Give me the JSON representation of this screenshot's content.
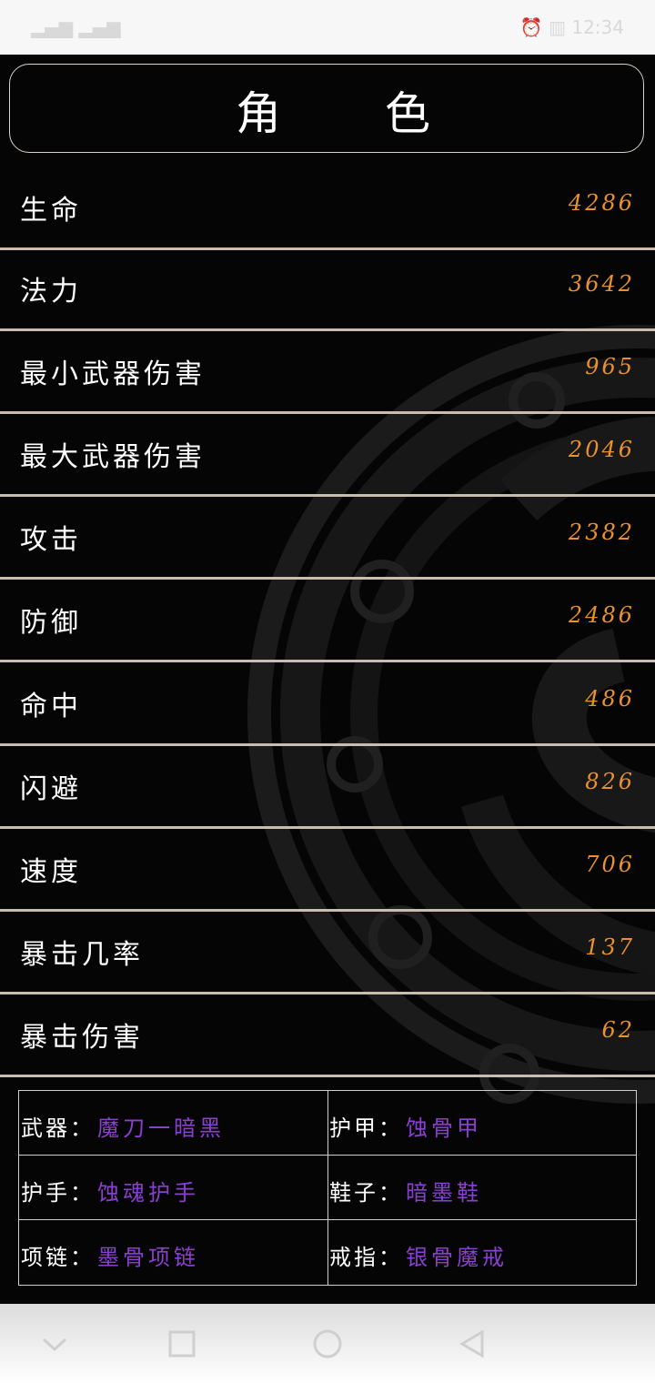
{
  "status_bar": {
    "left": "▂▄▆ ▂▄▆",
    "right": "⏰ ▥ 12:34"
  },
  "title": {
    "char1": "角",
    "char2": "色"
  },
  "stats": [
    {
      "label": "生命",
      "value": "4286"
    },
    {
      "label": "法力",
      "value": "3642"
    },
    {
      "label": "最小武器伤害",
      "value": "965"
    },
    {
      "label": "最大武器伤害",
      "value": "2046"
    },
    {
      "label": "攻击",
      "value": "2382"
    },
    {
      "label": "防御",
      "value": "2486"
    },
    {
      "label": "命中",
      "value": "486"
    },
    {
      "label": "闪避",
      "value": "826"
    },
    {
      "label": "速度",
      "value": "706"
    },
    {
      "label": "暴击几率",
      "value": "137"
    },
    {
      "label": "暴击伤害",
      "value": "62"
    }
  ],
  "equipment": [
    {
      "key": "武器：",
      "value": "魔刀一暗黑"
    },
    {
      "key": "护甲：",
      "value": "蚀骨甲"
    },
    {
      "key": "护手：",
      "value": "蚀魂护手"
    },
    {
      "key": "鞋子：",
      "value": "暗墨鞋"
    },
    {
      "key": "项链：",
      "value": "墨骨项链"
    },
    {
      "key": "戒指：",
      "value": "银骨魔戒"
    }
  ],
  "colors": {
    "value_orange": "#e8912e",
    "equip_purple": "#8a3fd0",
    "background": "#050505"
  },
  "nav_icons": [
    "chevron-down-icon",
    "recents-square-icon",
    "home-circle-icon",
    "back-triangle-icon"
  ]
}
